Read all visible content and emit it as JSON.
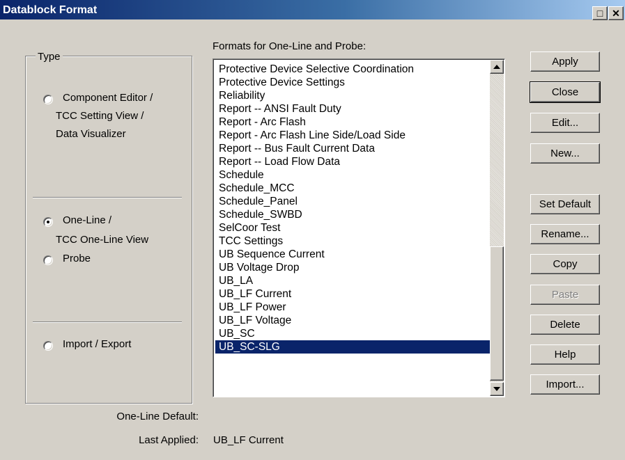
{
  "window": {
    "title": "Datablock Format"
  },
  "type_group": {
    "title": "Type",
    "options": [
      {
        "lines": [
          "Component Editor /",
          "TCC Setting View /",
          "Data Visualizer"
        ],
        "checked": false
      },
      {
        "lines": [
          "One-Line /",
          "TCC One-Line View"
        ],
        "checked": true
      },
      {
        "lines": [
          "Probe"
        ],
        "checked": false
      },
      {
        "lines": [
          "Import / Export"
        ],
        "checked": false
      }
    ]
  },
  "formats": {
    "label": "Formats for One-Line and Probe:",
    "items": [
      "Protective Device Selective Coordination",
      "Protective Device Settings",
      "Reliability",
      "Report -- ANSI Fault Duty",
      "Report - Arc Flash",
      "Report - Arc Flash Line Side/Load Side",
      "Report -- Bus Fault Current Data",
      "Report -- Load Flow Data",
      "Schedule",
      "Schedule_MCC",
      "Schedule_Panel",
      "Schedule_SWBD",
      "SelCoor Test",
      "TCC Settings",
      "UB Sequence Current",
      "UB Voltage Drop",
      "UB_LA",
      "UB_LF Current",
      "UB_LF Power",
      "UB_LF Voltage",
      "UB_SC",
      "UB_SC-SLG"
    ],
    "selected": "UB_SC-SLG"
  },
  "buttons": {
    "apply": "Apply",
    "close": "Close",
    "edit": "Edit...",
    "new": "New...",
    "set_default": "Set Default",
    "rename": "Rename...",
    "copy": "Copy",
    "paste": "Paste",
    "delete": "Delete",
    "help": "Help",
    "import": "Import..."
  },
  "footer": {
    "one_line_default_label": "One-Line Default:",
    "one_line_default_value": "",
    "last_applied_label": "Last Applied:",
    "last_applied_value": "UB_LF Current"
  }
}
